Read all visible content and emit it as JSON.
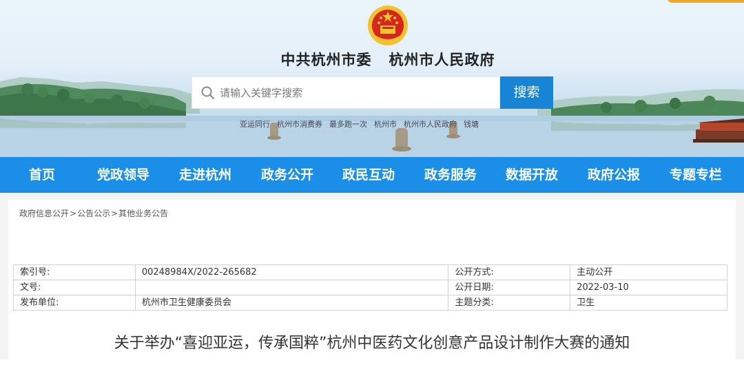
{
  "header": {
    "site_title": "中共杭州市委   杭州市人民政府",
    "emblem": "national-emblem",
    "search": {
      "placeholder": "请输入关键字搜索",
      "button_label": "搜索",
      "icon": "search-icon"
    },
    "hot_links": [
      "亚运同行",
      "杭州市消费券",
      "最多跑一次",
      "杭州市",
      "杭州市人民政府",
      "钱塘"
    ]
  },
  "nav": {
    "items": [
      {
        "label": "首页"
      },
      {
        "label": "党政领导"
      },
      {
        "label": "走进杭州"
      },
      {
        "label": "政务公开"
      },
      {
        "label": "政民互动"
      },
      {
        "label": "政务服务"
      },
      {
        "label": "数据开放"
      },
      {
        "label": "政府公报"
      },
      {
        "label": "专题专栏"
      }
    ]
  },
  "breadcrumb": {
    "items": [
      "政府信息公开",
      "公告公示",
      "其他业务公告"
    ],
    "separator": ">"
  },
  "info_table": {
    "rows": [
      {
        "label1": "索引号:",
        "value1": "00248984X/2022-265682",
        "label2": "公开方式:",
        "value2": "主动公开"
      },
      {
        "label1": "文号:",
        "value1": "",
        "label2": "公开日期:",
        "value2": "2022-03-10"
      },
      {
        "label1": "发布单位:",
        "value1": "杭州市卫生健康委员会",
        "label2": "主题分类:",
        "value2": "卫生"
      }
    ]
  },
  "article": {
    "title": "关于举办“喜迎亚运，传承国粹”杭州中医药文化创意产品设计制作大赛的通知"
  },
  "colors": {
    "nav_bg": "#1b8fe8",
    "search_button": "#1784d6",
    "corner_tab": "#f5a623",
    "emblem_red": "#d7261e",
    "emblem_gold": "#f2c230"
  }
}
